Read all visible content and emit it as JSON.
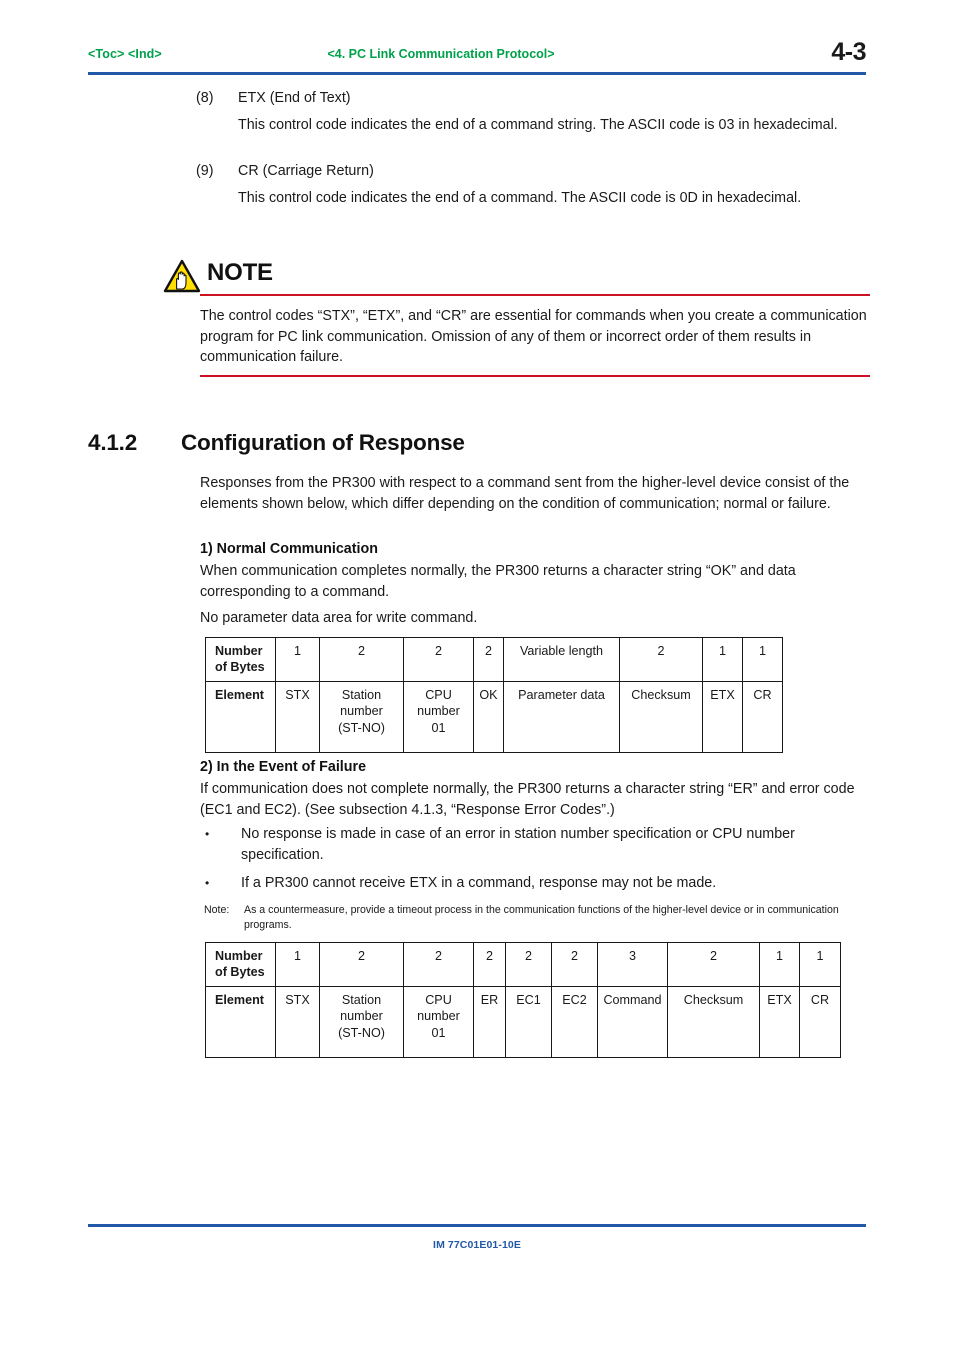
{
  "header": {
    "toc_links": "<Toc> <Ind>",
    "chapter_title": "<4.  PC Link Communication Protocol>",
    "page_number": "4-3"
  },
  "items": [
    {
      "number": "(8)",
      "title": "ETX (End of Text)",
      "body": "This control code indicates the end of a command string.  The ASCII code is 03 in hexadecimal."
    },
    {
      "number": "(9)",
      "title": "CR (Carriage Return)",
      "body": "This control code indicates the end of a command.  The ASCII code is 0D in hexadecimal."
    }
  ],
  "note": {
    "heading": "NOTE",
    "icon": "warning-hand-triangle-icon",
    "text": "The control codes “STX”, “ETX”, and “CR” are essential for commands when you create a communication program for PC link communication.  Omission of any of them or incorrect order of them results in communication failure.",
    "rule_color": "#cc1122"
  },
  "section": {
    "number": "4.1.2",
    "title": "Configuration of Response",
    "intro": "Responses from the PR300 with respect to a command sent from the higher-level device consist of the elements shown below, which differ depending on the condition of communication; normal or failure."
  },
  "normal": {
    "heading": "1) Normal Communication",
    "paragraph": "When communication completes normally, the PR300 returns a character string “OK” and data corresponding to a command.",
    "note_line": "No parameter data area for write command.",
    "table": {
      "row_labels": [
        "Number of Bytes",
        "Element"
      ],
      "bytes": [
        "1",
        "2",
        "2",
        "2",
        "Variable length",
        "2",
        "1",
        "1"
      ],
      "elements": [
        "STX",
        "Station number (ST-NO)",
        "CPU number 01",
        "OK",
        "Parameter data",
        "Checksum",
        "ETX",
        "CR"
      ],
      "element_lines": [
        [
          "STX"
        ],
        [
          "Station",
          "number",
          "(ST-NO)"
        ],
        [
          "CPU",
          "number",
          "01"
        ],
        [
          "OK"
        ],
        [
          "Parameter data"
        ],
        [
          "Checksum"
        ],
        [
          "ETX"
        ],
        [
          "CR"
        ]
      ]
    }
  },
  "failure": {
    "heading": "2) In the Event of Failure",
    "paragraph": "If communication does not complete normally, the PR300 returns a character string “ER” and error code (EC1 and EC2). (See subsection 4.1.3, “Response Error Codes”.)",
    "bullets": [
      "No response is made in case of an error in station number specification or CPU number specification.",
      "If a PR300 cannot receive ETX in a command, response may not be made."
    ],
    "note_label": "Note:",
    "note_body": "As a countermeasure, provide a timeout process in the communication functions of the higher-level device or in communication programs.",
    "table": {
      "row_labels": [
        "Number of Bytes",
        "Element"
      ],
      "bytes": [
        "1",
        "2",
        "2",
        "2",
        "2",
        "2",
        "3",
        "2",
        "1",
        "1"
      ],
      "elements": [
        "STX",
        "Station number (ST-NO)",
        "CPU number 01",
        "ER",
        "EC1",
        "EC2",
        "Command",
        "Checksum",
        "ETX",
        "CR"
      ],
      "element_lines": [
        [
          "STX"
        ],
        [
          "Station",
          "number",
          "(ST-NO)"
        ],
        [
          "CPU",
          "number",
          "01"
        ],
        [
          "ER"
        ],
        [
          "EC1"
        ],
        [
          "EC2"
        ],
        [
          "Command"
        ],
        [
          "Checksum"
        ],
        [
          "ETX"
        ],
        [
          "CR"
        ]
      ]
    }
  },
  "footer": {
    "document_code": "IM 77C01E01-10E",
    "rule_color": "#2358a8"
  }
}
